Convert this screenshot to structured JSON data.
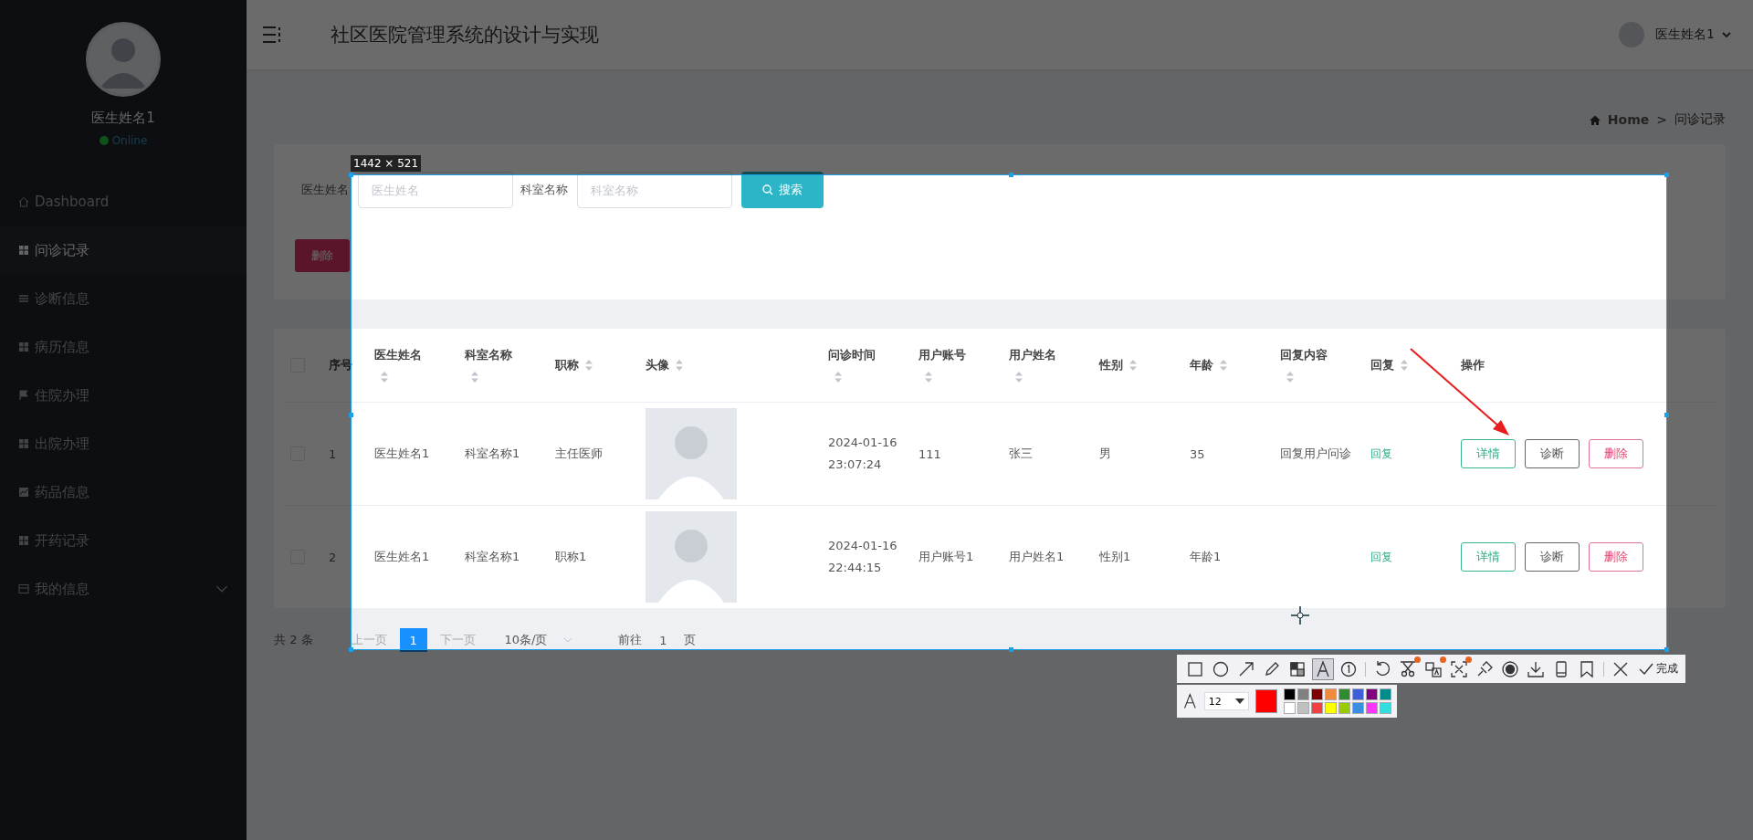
{
  "sidebar": {
    "user_name": "医生姓名1",
    "status": "Online",
    "items": [
      {
        "label": "Dashboard",
        "kind": "home",
        "selected": false
      },
      {
        "label": "问诊记录",
        "kind": "grid",
        "selected": true
      },
      {
        "label": "诊断信息",
        "kind": "list",
        "selected": false
      },
      {
        "label": "病历信息",
        "kind": "grid",
        "selected": false
      },
      {
        "label": "住院办理",
        "kind": "flag",
        "selected": false
      },
      {
        "label": "出院办理",
        "kind": "grid",
        "selected": false
      },
      {
        "label": "药品信息",
        "kind": "chart",
        "selected": false
      },
      {
        "label": "开药记录",
        "kind": "grid",
        "selected": false
      },
      {
        "label": "我的信息",
        "kind": "card",
        "selected": false,
        "expanded": false
      }
    ]
  },
  "header": {
    "title": "社区医院管理系统的设计与实现",
    "user_name": "医生姓名1"
  },
  "breadcrumb": {
    "home": "Home",
    "separator": ">",
    "current": "问诊记录"
  },
  "search": {
    "fields": [
      {
        "label": "医生姓名",
        "placeholder": "医生姓名"
      },
      {
        "label": "科室名称",
        "placeholder": "科室名称"
      }
    ],
    "search_button": "搜索",
    "delete_button": "删除"
  },
  "table": {
    "header_checkbox": {
      "checked": false
    },
    "columns": [
      {
        "label": "序号",
        "sortable": false
      },
      {
        "label": "医生姓名",
        "sortable": true
      },
      {
        "label": "科室名称",
        "sortable": true
      },
      {
        "label": "职称",
        "sortable": true
      },
      {
        "label": "头像",
        "sortable": true
      },
      {
        "label": "问诊时间",
        "sortable": true
      },
      {
        "label": "用户账号",
        "sortable": true
      },
      {
        "label": "用户姓名",
        "sortable": true
      },
      {
        "label": "性别",
        "sortable": true
      },
      {
        "label": "年龄",
        "sortable": true
      },
      {
        "label": "回复内容",
        "sortable": true
      },
      {
        "label": "回复",
        "sortable": true
      },
      {
        "label": "操作",
        "sortable": false
      }
    ],
    "rows": [
      {
        "checked": false,
        "index": "1",
        "doctor": "医生姓名1",
        "department": "科室名称1",
        "title": "主任医师",
        "time": "2024-01-16 23:07:24",
        "account": "111",
        "user": "张三",
        "gender": "男",
        "age": "35",
        "reply_content": "回复用户问诊",
        "reply": "回复",
        "actions": [
          {
            "label": "详情",
            "kind": "detail"
          },
          {
            "label": "诊断",
            "kind": "diagnose"
          },
          {
            "label": "删除",
            "kind": "delete"
          }
        ]
      },
      {
        "checked": false,
        "index": "2",
        "doctor": "医生姓名1",
        "department": "科室名称1",
        "title": "职称1",
        "time": "2024-01-16 22:44:15",
        "account": "用户账号1",
        "user": "用户姓名1",
        "gender": "性别1",
        "age": "年龄1",
        "reply_content": "",
        "reply": "回复",
        "actions": [
          {
            "label": "详情",
            "kind": "detail"
          },
          {
            "label": "诊断",
            "kind": "diagnose"
          },
          {
            "label": "删除",
            "kind": "delete"
          }
        ]
      }
    ]
  },
  "pagination": {
    "total": "共 2 条",
    "prev": "上一页",
    "pages": [
      {
        "label": "1",
        "selected": true
      }
    ],
    "next": "下一页",
    "page_size": "10条/页",
    "goto_label": "前往",
    "goto_value": "1",
    "goto_suffix": "页"
  },
  "capture": {
    "size_label": "1442 × 521",
    "tool_groups": [
      [
        {
          "kind": "rect",
          "selected": false,
          "dot": false
        },
        {
          "kind": "circle",
          "selected": false,
          "dot": false
        },
        {
          "kind": "arrow",
          "selected": false,
          "dot": false
        },
        {
          "kind": "pencil",
          "selected": false,
          "dot": false
        },
        {
          "kind": "mosaic",
          "selected": false,
          "dot": false
        },
        {
          "kind": "text",
          "selected": true,
          "dot": false
        },
        {
          "kind": "number",
          "selected": false,
          "dot": false
        }
      ],
      [
        {
          "kind": "undo",
          "selected": false,
          "dot": false
        },
        {
          "kind": "scissors",
          "selected": false,
          "dot": true
        },
        {
          "kind": "translate",
          "selected": false,
          "dot": true
        },
        {
          "kind": "ocr",
          "selected": false,
          "dot": true
        },
        {
          "kind": "pin",
          "selected": false,
          "dot": false
        },
        {
          "kind": "record",
          "selected": false,
          "dot": false
        },
        {
          "kind": "download",
          "selected": false,
          "dot": false
        },
        {
          "kind": "phone",
          "selected": false,
          "dot": false
        },
        {
          "kind": "bookmark",
          "selected": false,
          "dot": false
        }
      ],
      [
        {
          "kind": "close",
          "selected": false,
          "dot": false
        }
      ]
    ],
    "done_button": "完成",
    "font_size": "12",
    "current_swatch": {
      "color": "#ff0000"
    },
    "palette": [
      {
        "color": "#000000"
      },
      {
        "color": "#808080"
      },
      {
        "color": "#800000"
      },
      {
        "color": "#f08a3c"
      },
      {
        "color": "#2e8b2e"
      },
      {
        "color": "#3e5fd8"
      },
      {
        "color": "#800080"
      },
      {
        "color": "#008b8b"
      },
      {
        "color": "#ffffff"
      },
      {
        "color": "#c0c0c0"
      },
      {
        "color": "#f04040"
      },
      {
        "color": "#ffff00"
      },
      {
        "color": "#99cc00"
      },
      {
        "color": "#3b8fe0"
      },
      {
        "color": "#ff33ff"
      },
      {
        "color": "#33dddd"
      }
    ]
  }
}
